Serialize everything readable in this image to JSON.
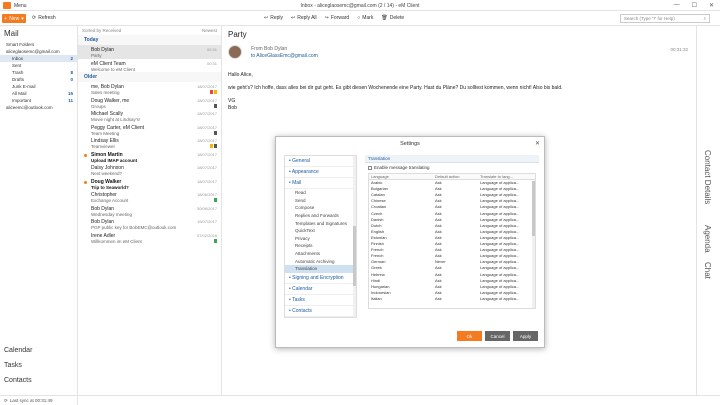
{
  "window": {
    "title": "Inbox - aliceglaosemc@gmail.com (2 / 14) - eM Client",
    "menu_label": "Menu",
    "controls": [
      "—",
      "☐",
      "✕"
    ]
  },
  "toolbar": {
    "new_label": "New",
    "refresh_label": "Refresh",
    "reply_label": "Reply",
    "reply_all_label": "Reply All",
    "forward_label": "Forward",
    "mark_label": "Mark",
    "delete_label": "Delete",
    "search_placeholder": "Search (Type '?' for Help)"
  },
  "sidebar": {
    "heading": "Mail",
    "smart_folders": "Smart Folders",
    "account1": "aliceglaosemc@gmail.com",
    "folders": [
      {
        "name": "Inbox",
        "count": "2",
        "selected": true
      },
      {
        "name": "Sent",
        "count": ""
      },
      {
        "name": "Trash",
        "count": "8"
      },
      {
        "name": "Drafts",
        "count": "0"
      },
      {
        "name": "Junk E-mail",
        "count": ""
      },
      {
        "name": "All Mail",
        "count": "15"
      },
      {
        "name": "Important",
        "count": "11"
      }
    ],
    "account2": "aliceemc@outlook.com",
    "nav_calendar": "Calendar",
    "nav_tasks": "Tasks",
    "nav_contacts": "Contacts"
  },
  "status": {
    "last_sync": "Last sync at 00:31:49"
  },
  "message_list": {
    "sort_label": "Sorted by Received",
    "order_label": "Newest",
    "group_today": "Today",
    "group_older": "Older",
    "today": [
      {
        "from": "Bob Dylan",
        "subject": "Party",
        "date": "00:31",
        "selected": true
      }
    ],
    "today2": [
      {
        "from": "eM Client Team",
        "subject": "Welcome to eM Client",
        "date": "00:31"
      }
    ],
    "older": [
      {
        "from": "me, Bob Dylan",
        "subject": "Sales meeting",
        "date": "18/07/2017",
        "tags": [
          "#e8483a",
          "#f5b800"
        ]
      },
      {
        "from": "Doug Walker, me",
        "subject": "Groups",
        "date": "18/07/2017",
        "tags": [
          "#555555"
        ]
      },
      {
        "from": "Michael Scally",
        "subject": "Movie night at Lindsay's!",
        "date": "18/07/2017"
      },
      {
        "from": "Peggy Carter, eM Client",
        "subject": "Team Meeting",
        "date": "18/07/2017",
        "tags": [
          "#555555"
        ]
      },
      {
        "from": "Lindsay Ellis",
        "subject": "Teamviewer",
        "date": "18/07/2017",
        "tags": [
          "#f5b800",
          "#555555"
        ]
      },
      {
        "from": "Simon Martin",
        "subject": "Upload IMAP account",
        "date": "18/07/2017",
        "unread": true
      },
      {
        "from": "Daisy Johnson",
        "subject": "Next weekend?",
        "date": "18/07/2017"
      },
      {
        "from": "Doug Walker",
        "subject": "Trip to Seaworld?",
        "date": "18/07/2017",
        "unread": true
      },
      {
        "from": "Christopher",
        "subject": "Exchange Account",
        "date": "18/06/2017",
        "tags": [
          "#3aa655"
        ]
      },
      {
        "from": "Bob Dylan",
        "subject": "Wednesday meeting",
        "date": "30/06/2017"
      },
      {
        "from": "Bob Dylan",
        "subject": "PGP public key for BobEMC@outlook.com",
        "date": "19/07/2017"
      },
      {
        "from": "Irene Adler",
        "subject": "Willkommen im eM Client",
        "date": "07/02/2016",
        "tags": [
          "#3aa655"
        ]
      }
    ]
  },
  "reading": {
    "subject": "Party",
    "from_line": "From Bob Dylan",
    "to_line": "to AliceGlassEmc@gmail.com",
    "time": "00:31:32",
    "body": [
      "Hallo Alice,",
      "",
      "wie geht's? Ich hoffe, dass alles bei dir gut geht. Es gibt diesen Wochenende eine Party. Hast du Pläne? Du solltest kommen, wenn nicht! Also bis bald.",
      "",
      "VG",
      "Bob"
    ]
  },
  "right_tabs": {
    "contact_details": "Contact Details",
    "agenda": "Agenda",
    "chat": "Chat"
  },
  "settings": {
    "title": "Settings",
    "nav": [
      {
        "label": "General",
        "type": "sec"
      },
      {
        "label": "Appearance",
        "type": "sec"
      },
      {
        "label": "Mail",
        "type": "sec"
      },
      {
        "label": "Read",
        "type": "sub"
      },
      {
        "label": "Send",
        "type": "sub"
      },
      {
        "label": "Compose",
        "type": "sub"
      },
      {
        "label": "Replies and Forwards",
        "type": "sub"
      },
      {
        "label": "Templates and Signatures",
        "type": "sub"
      },
      {
        "label": "QuickText",
        "type": "sub"
      },
      {
        "label": "Privacy",
        "type": "sub"
      },
      {
        "label": "Receipts",
        "type": "sub"
      },
      {
        "label": "Attachments",
        "type": "sub"
      },
      {
        "label": "Automatic Archiving",
        "type": "sub"
      },
      {
        "label": "Translation",
        "type": "sub",
        "selected": true
      },
      {
        "label": "Signing and Encryption",
        "type": "sec"
      },
      {
        "label": "Calendar",
        "type": "sec"
      },
      {
        "label": "Tasks",
        "type": "sec"
      },
      {
        "label": "Contacts",
        "type": "sec"
      }
    ],
    "section_title": "Translation",
    "enable_label": "Enable message translating",
    "columns": [
      "Language",
      "Default action",
      "Translate to lang..."
    ],
    "rows": [
      [
        "Arabic",
        "Ask",
        "Language of applica..."
      ],
      [
        "Bulgarian",
        "Ask",
        "Language of applica..."
      ],
      [
        "Catalan",
        "Ask",
        "Language of applica..."
      ],
      [
        "Chinese",
        "Ask",
        "Language of applica..."
      ],
      [
        "Croatian",
        "Ask",
        "Language of applica..."
      ],
      [
        "Czech",
        "Ask",
        "Language of applica..."
      ],
      [
        "Danish",
        "Ask",
        "Language of applica..."
      ],
      [
        "Dutch",
        "Ask",
        "Language of applica..."
      ],
      [
        "English",
        "Ask",
        "Language of applica..."
      ],
      [
        "Estonian",
        "Ask",
        "Language of applica..."
      ],
      [
        "Finnish",
        "Ask",
        "Language of applica..."
      ],
      [
        "French",
        "Ask",
        "Language of applica..."
      ],
      [
        "French",
        "Ask",
        "Language of applica..."
      ],
      [
        "German",
        "Never",
        "Language of applica..."
      ],
      [
        "Greek",
        "Ask",
        "Language of applica..."
      ],
      [
        "Hebrew",
        "Ask",
        "Language of applica..."
      ],
      [
        "Hindi",
        "Ask",
        "Language of applica..."
      ],
      [
        "Hungarian",
        "Ask",
        "Language of applica..."
      ],
      [
        "Indonesian",
        "Ask",
        "Language of applica..."
      ],
      [
        "Italian",
        "Ask",
        "Language of applica..."
      ]
    ],
    "ok_label": "Ok",
    "cancel_label": "Cancel",
    "apply_label": "Apply"
  },
  "colors": {
    "accent": "#f47b20",
    "link": "#1c5a9c"
  }
}
